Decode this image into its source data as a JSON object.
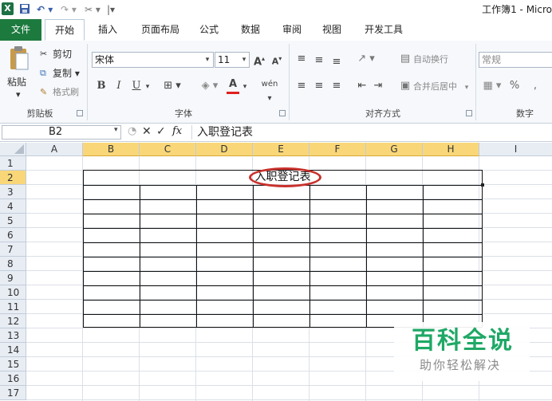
{
  "window": {
    "title": "工作簿1 - Micro"
  },
  "tabs": [
    "文件",
    "开始",
    "插入",
    "页面布局",
    "公式",
    "数据",
    "审阅",
    "视图",
    "开发工具"
  ],
  "clipboard": {
    "paste": "粘贴",
    "cut": "剪切",
    "copy": "复制 ▾",
    "format_painter": "格式刷",
    "label": "剪贴板"
  },
  "font": {
    "name": "宋体",
    "size": "11",
    "bold": "B",
    "italic": "I",
    "underline": "U",
    "label": "字体"
  },
  "alignment": {
    "wrap_text": "自动换行",
    "merge_center": "合并后居中",
    "label": "对齐方式"
  },
  "number": {
    "format": "常规",
    "percent": "%",
    "comma": ",",
    "label": "数字"
  },
  "formula_bar": {
    "name_box": "B2",
    "fx": "fx",
    "content": "入职登记表"
  },
  "columns": [
    "A",
    "B",
    "C",
    "D",
    "E",
    "F",
    "G",
    "H",
    "I"
  ],
  "selected_columns": [
    "B",
    "C",
    "D",
    "E",
    "F",
    "G",
    "H"
  ],
  "rows": [
    "1",
    "2",
    "3",
    "4",
    "5",
    "6",
    "7",
    "8",
    "9",
    "10",
    "11",
    "12",
    "13",
    "14",
    "15",
    "16",
    "17"
  ],
  "selected_row": "2",
  "sheet": {
    "title_cell": "入职登记表"
  },
  "watermark": {
    "main": "百科全说",
    "sub": "助你轻松解决"
  },
  "colors": {
    "accent": "#1d7a3f",
    "selection": "#f9d779",
    "highlight_ring": "#c8312c",
    "watermark": "#1fa866"
  }
}
